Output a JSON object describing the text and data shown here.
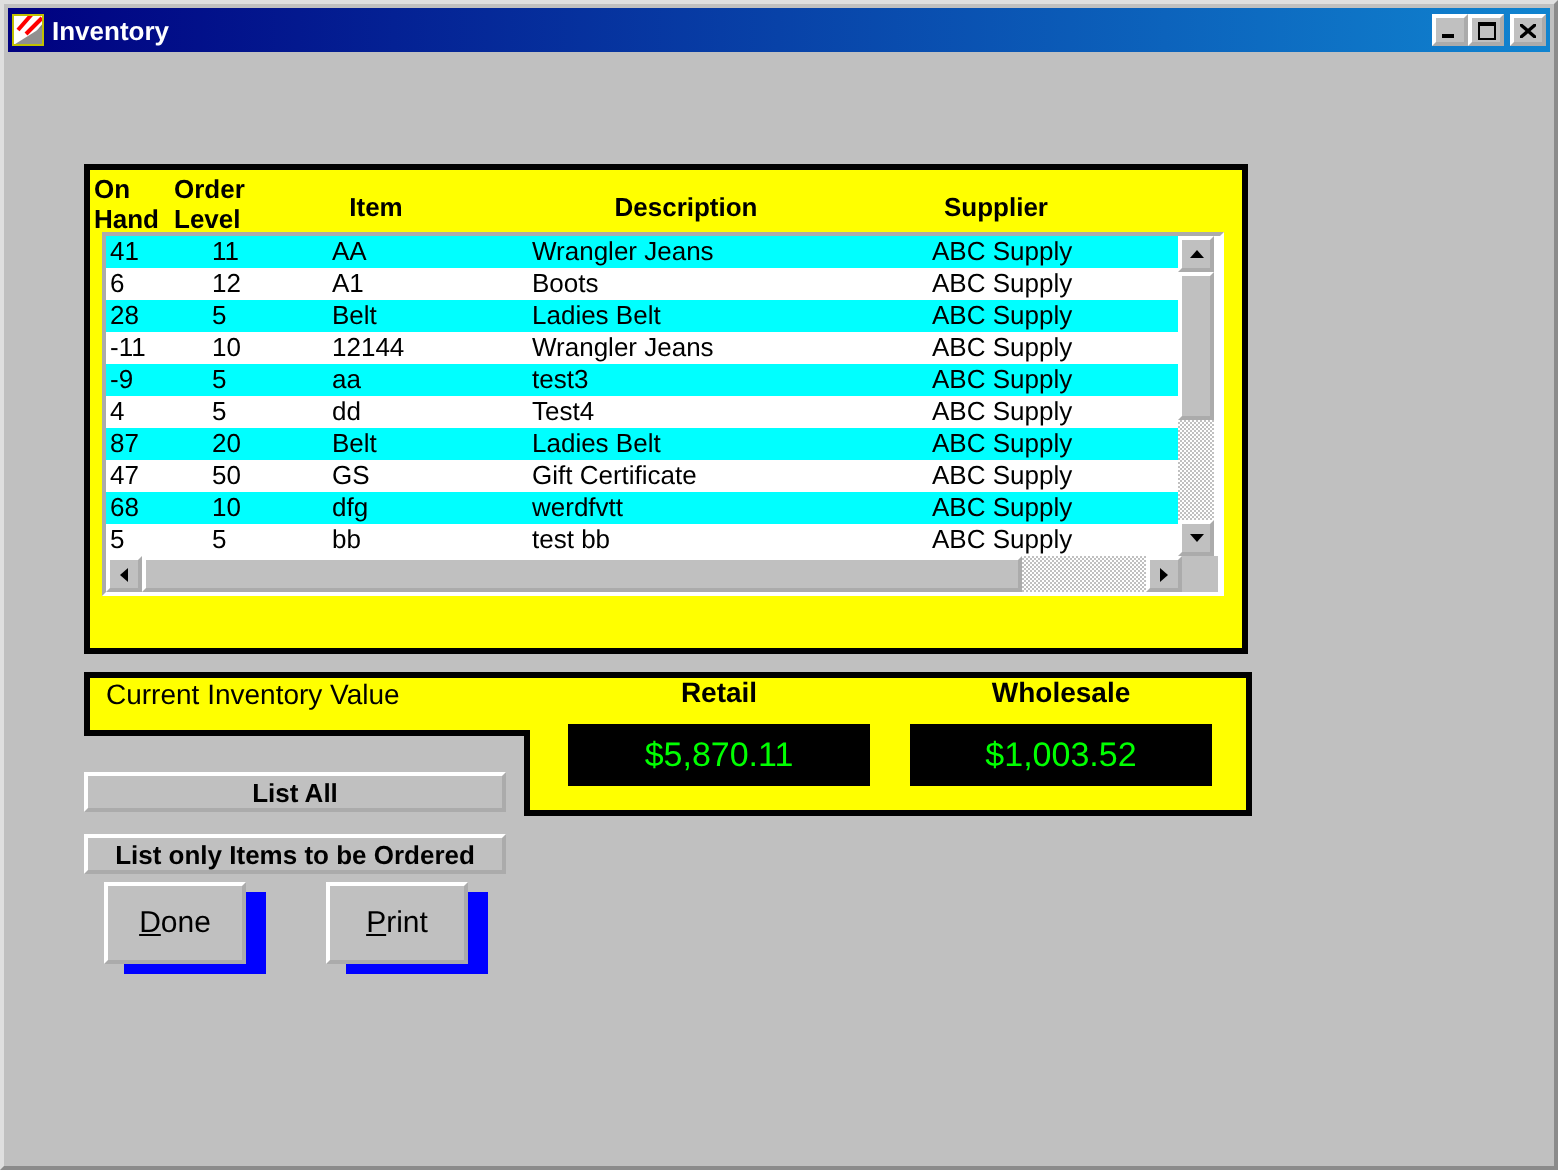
{
  "window": {
    "title": "Inventory"
  },
  "table": {
    "columns": [
      {
        "lines": [
          "On",
          "Hand"
        ]
      },
      {
        "lines": [
          "Order",
          "Level"
        ]
      },
      {
        "lines": [
          "Item"
        ]
      },
      {
        "lines": [
          "Description"
        ]
      },
      {
        "lines": [
          "Supplier"
        ]
      }
    ],
    "rows": [
      [
        "41",
        "11",
        "AA",
        "Wrangler Jeans",
        "ABC Supply"
      ],
      [
        "6",
        "12",
        "A1",
        "Boots",
        "ABC Supply"
      ],
      [
        "28",
        "5",
        "Belt",
        "Ladies Belt",
        "ABC Supply"
      ],
      [
        "-11",
        "10",
        "12144",
        "Wrangler Jeans",
        "ABC Supply"
      ],
      [
        "-9",
        "5",
        "aa",
        "test3",
        "ABC Supply"
      ],
      [
        "4",
        "5",
        "dd",
        "Test4",
        "ABC Supply"
      ],
      [
        "87",
        "20",
        "Belt",
        "Ladies Belt",
        "ABC Supply"
      ],
      [
        "47",
        "50",
        "GS",
        "Gift Certificate",
        "ABC Supply"
      ],
      [
        "68",
        "10",
        "dfg",
        "werdfvtt",
        "ABC Supply"
      ],
      [
        "5",
        "5",
        "bb",
        "test bb",
        "ABC Supply"
      ]
    ]
  },
  "inventory_value": {
    "title": "Current Inventory Value",
    "retail_label": "Retail",
    "retail": "$5,870.11",
    "wholesale_label": "Wholesale",
    "wholesale": "$1,003.52"
  },
  "filter_buttons": [
    "List All",
    "List only Items to be Ordered"
  ],
  "action_buttons": [
    "Done",
    "Print"
  ]
}
